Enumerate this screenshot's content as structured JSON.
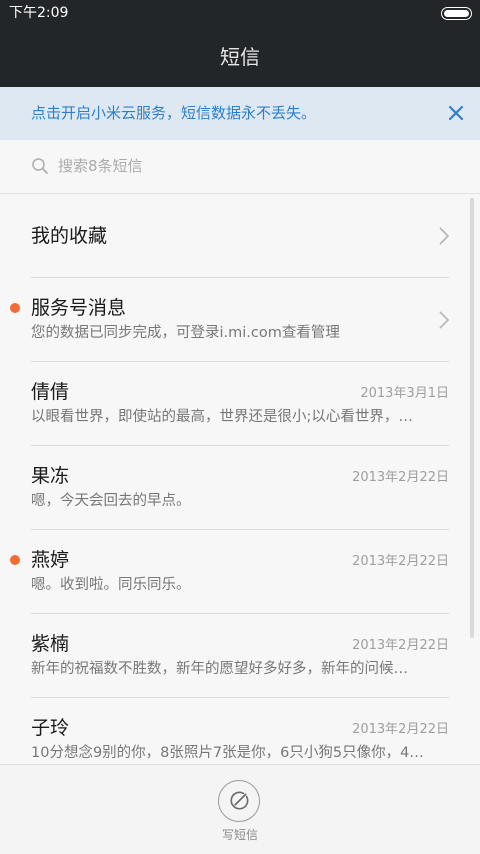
{
  "status_bar": {
    "time": "下午2:09"
  },
  "header": {
    "title": "短信"
  },
  "banner": {
    "text": "点击开启小米云服务，短信数据永不丢失。"
  },
  "search": {
    "placeholder": "搜索8条短信"
  },
  "favorites": {
    "label": "我的收藏"
  },
  "service": {
    "name": "服务号消息",
    "preview": "您的数据已同步完成，可登录i.mi.com查看管理",
    "unread": true
  },
  "conversations": [
    {
      "name": "倩倩",
      "date": "2013年3月1日",
      "preview": "以眼看世界，即使站的最高，世界还是很小;以心看世界，…",
      "unread": false
    },
    {
      "name": "果冻",
      "date": "2013年2月22日",
      "preview": "嗯，今天会回去的早点。",
      "unread": false
    },
    {
      "name": "燕婷",
      "date": "2013年2月22日",
      "preview": "嗯。收到啦。同乐同乐。",
      "unread": true
    },
    {
      "name": "紫楠",
      "date": "2013年2月22日",
      "preview": "新年的祝福数不胜数，新年的愿望好多好多，新年的问候…",
      "unread": false
    },
    {
      "name": "子玲",
      "date": "2013年2月22日",
      "preview": "10分想念9别的你，8张照片7张是你，6只小狗5只像你，4…",
      "unread": false
    }
  ],
  "bottom_bar": {
    "compose_label": "写短信"
  },
  "colors": {
    "accent": "#2f7fc8",
    "unread_dot": "#f26b32",
    "header_bg": "#222628"
  },
  "icons": {
    "close": "close-icon",
    "search": "search-icon",
    "chevron": "chevron-right-icon",
    "compose": "compose-icon",
    "battery": "battery-icon"
  }
}
